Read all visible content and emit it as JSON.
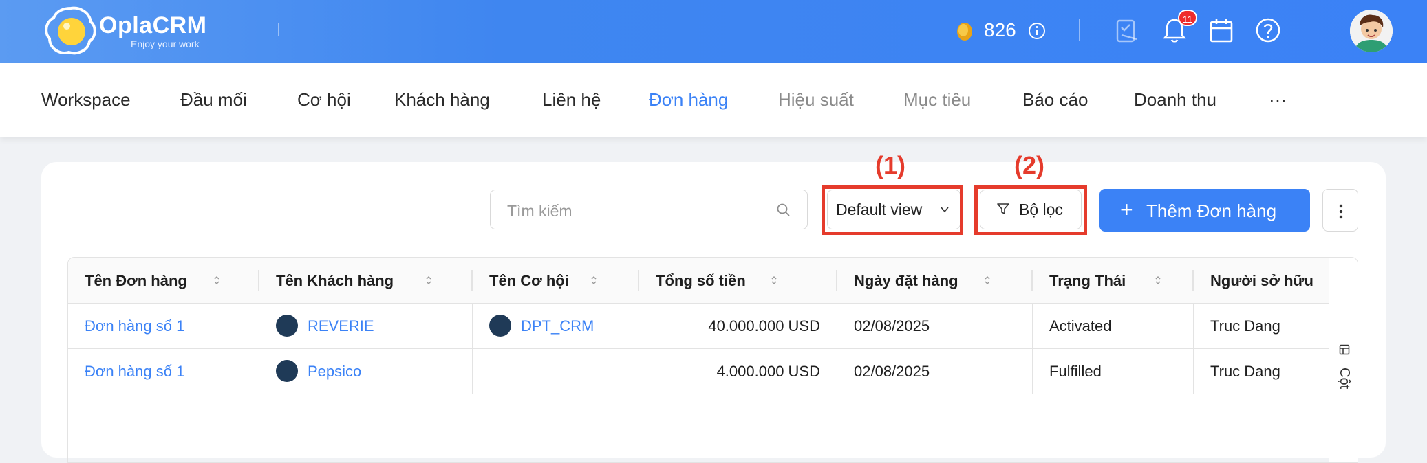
{
  "header": {
    "brand": "OplaCRM",
    "tagline": "Enjoy your work",
    "coin_count": "826",
    "notification_count": "11"
  },
  "nav": {
    "items": [
      {
        "label": "Workspace"
      },
      {
        "label": "Đầu mối"
      },
      {
        "label": "Cơ hội"
      },
      {
        "label": "Khách hàng"
      },
      {
        "label": "Liên hệ"
      },
      {
        "label": "Đơn hàng"
      },
      {
        "label": "Hiệu suất"
      },
      {
        "label": "Mục tiêu"
      },
      {
        "label": "Báo cáo"
      },
      {
        "label": "Doanh thu"
      },
      {
        "label": "···"
      }
    ],
    "active": "Đơn hàng"
  },
  "toolbar": {
    "search_placeholder": "Tìm kiếm",
    "view_label": "Default view",
    "filter_label": "Bộ lọc",
    "add_label": "Thêm Đơn hàng",
    "annotation_1": "(1)",
    "annotation_2": "(2)"
  },
  "table": {
    "columns": [
      "Tên Đơn hàng",
      "Tên Khách hàng",
      "Tên Cơ hội",
      "Tổng số tiền",
      "Ngày đặt hàng",
      "Trạng Thái",
      "Người sở hữu"
    ],
    "rows": [
      {
        "order": "Đơn hàng số 1",
        "customer": "REVERIE",
        "opportunity": "DPT_CRM",
        "total": "40.000.000 USD",
        "date": "02/08/2025",
        "status": "Activated",
        "owner": "Truc Dang"
      },
      {
        "order": "Đơn hàng số 1",
        "customer": "Pepsico",
        "opportunity": "",
        "total": "4.000.000 USD",
        "date": "02/08/2025",
        "status": "Fulfilled",
        "owner": "Truc Dang"
      }
    ],
    "columns_panel_label": "Cột"
  },
  "colors": {
    "primary": "#3b82f6",
    "annotation": "#e53b2c",
    "badge": "#ef2b2b"
  }
}
